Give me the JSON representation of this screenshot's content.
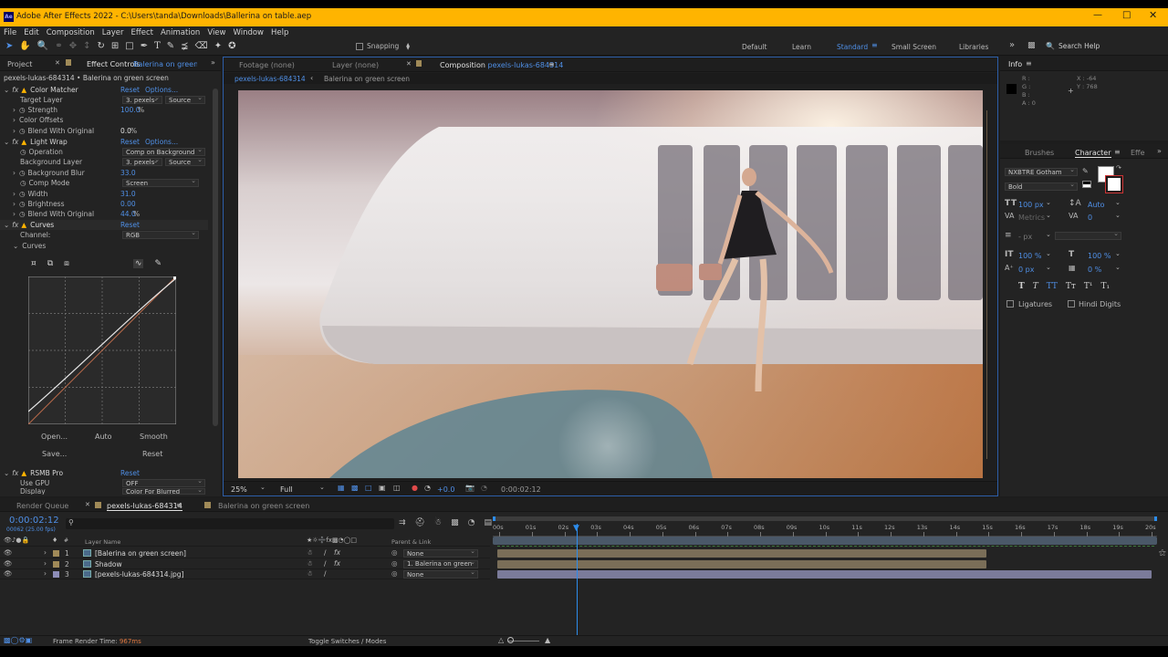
{
  "app": {
    "title": "Adobe After Effects 2022 - C:\\Users\\tanda\\Downloads\\Ballerina on table.aep",
    "logo": "Ae"
  },
  "menu": [
    "File",
    "Edit",
    "Composition",
    "Layer",
    "Effect",
    "Animation",
    "View",
    "Window",
    "Help"
  ],
  "toolbar": {
    "snapping": "Snapping"
  },
  "workspaces": [
    "Default",
    "Learn",
    "Standard",
    "Small Screen",
    "Libraries"
  ],
  "search_placeholder": "Search Help",
  "left_tabs": {
    "project": "Project",
    "effect_controls": "Effect Controls",
    "effect_target": "Balerina on green scr",
    "breadcrumb": "pexels-lukas-684314 • Balerina on green screen"
  },
  "effects": {
    "color_matcher": {
      "name": "Color Matcher",
      "reset": "Reset",
      "options": "Options...",
      "target_layer_label": "Target Layer",
      "target_layer": "3. pexels-",
      "target_source": "Source",
      "strength_label": "Strength",
      "strength": "100.0",
      "strength_unit": "%",
      "offsets_label": "Color Offsets",
      "blend_label": "Blend With Original",
      "blend": "0.0",
      "blend_unit": "%"
    },
    "light_wrap": {
      "name": "Light Wrap",
      "reset": "Reset",
      "options": "Options...",
      "operation_label": "Operation",
      "operation": "Comp on Background",
      "bg_layer_label": "Background Layer",
      "bg_layer": "3. pexels-",
      "bg_source": "Source",
      "bg_blur_label": "Background Blur",
      "bg_blur": "33.0",
      "comp_mode_label": "Comp Mode",
      "comp_mode": "Screen",
      "width_label": "Width",
      "width": "31.0",
      "brightness_label": "Brightness",
      "brightness": "0.00",
      "blend_label": "Blend With Original",
      "blend": "44.0",
      "blend_unit": "%"
    },
    "curves": {
      "name": "Curves",
      "reset": "Reset",
      "channel_label": "Channel:",
      "channel": "RGB",
      "curves_label": "Curves",
      "open": "Open...",
      "auto": "Auto",
      "smooth": "Smooth",
      "save": "Save...",
      "reset2": "Reset"
    },
    "rsmb": {
      "name": "RSMB Pro",
      "reset": "Reset",
      "gpu_label": "Use GPU",
      "gpu": "OFF",
      "display_label": "Display",
      "display": "Color For Blurred"
    }
  },
  "viewer_tabs": {
    "footage": "Footage",
    "footage_val": "(none)",
    "layer": "Layer",
    "layer_val": "(none)",
    "composition": "Composition",
    "comp_name": "pexels-lukas-684314"
  },
  "viewer_crumbs": [
    "pexels-lukas-684314",
    "Balerina on green screen"
  ],
  "viewer_footer": {
    "zoom": "25%",
    "resolution": "Full",
    "exposure": "+0.0",
    "time": "0:00:02:12"
  },
  "info": {
    "title": "Info",
    "r": "R :",
    "g": "G :",
    "b": "B :",
    "a": "A :",
    "a_val": "0",
    "x": "X : -64",
    "y": "Y : 768"
  },
  "char_tabs": [
    "Brushes",
    "Character",
    "Effe"
  ],
  "character": {
    "font": "NXBTRE Gotham",
    "style": "Bold",
    "size": "100",
    "size_unit": "px",
    "leading": "Auto",
    "kerning": "Metrics",
    "tracking": "0",
    "stroke_unit": "- px",
    "vscale": "100",
    "hscale": "100",
    "baseline": "0",
    "baseline_unit": "px",
    "tsume": "0",
    "pct": "%",
    "ligatures": "Ligatures",
    "hindi": "Hindi Digits"
  },
  "render_queue": "Render Queue",
  "timeline_tabs": [
    "pexels-lukas-684314",
    "Balerina on green screen"
  ],
  "timecode": "0:00:02:12",
  "frame_info": "00062 (25.00 fps)",
  "layer_header": {
    "name": "Layer Name",
    "parent": "Parent & Link"
  },
  "layers": [
    {
      "num": "1",
      "name": "[Balerina on green screen]",
      "parent": "None",
      "color": "#a08a58"
    },
    {
      "num": "2",
      "name": "Shadow",
      "parent": "1. Balerina on green",
      "color": "#a08a58"
    },
    {
      "num": "3",
      "name": "[pexels-lukas-684314.jpg]",
      "parent": "None",
      "color": "#8d8db8"
    }
  ],
  "ruler": [
    "00s",
    "01s",
    "02s",
    "03s",
    "04s",
    "05s",
    "06s",
    "07s",
    "08s",
    "09s",
    "10s",
    "11s",
    "12s",
    "13s",
    "14s",
    "15s",
    "16s",
    "17s",
    "18s",
    "19s",
    "20s"
  ],
  "status": {
    "render_label": "Frame Render Time:",
    "render_val": "967ms",
    "toggle": "Toggle Switches / Modes"
  },
  "colors": {
    "accent": "#4f8fe6",
    "titlebar": "#ffb400",
    "playhead": "#2d8ceb"
  }
}
